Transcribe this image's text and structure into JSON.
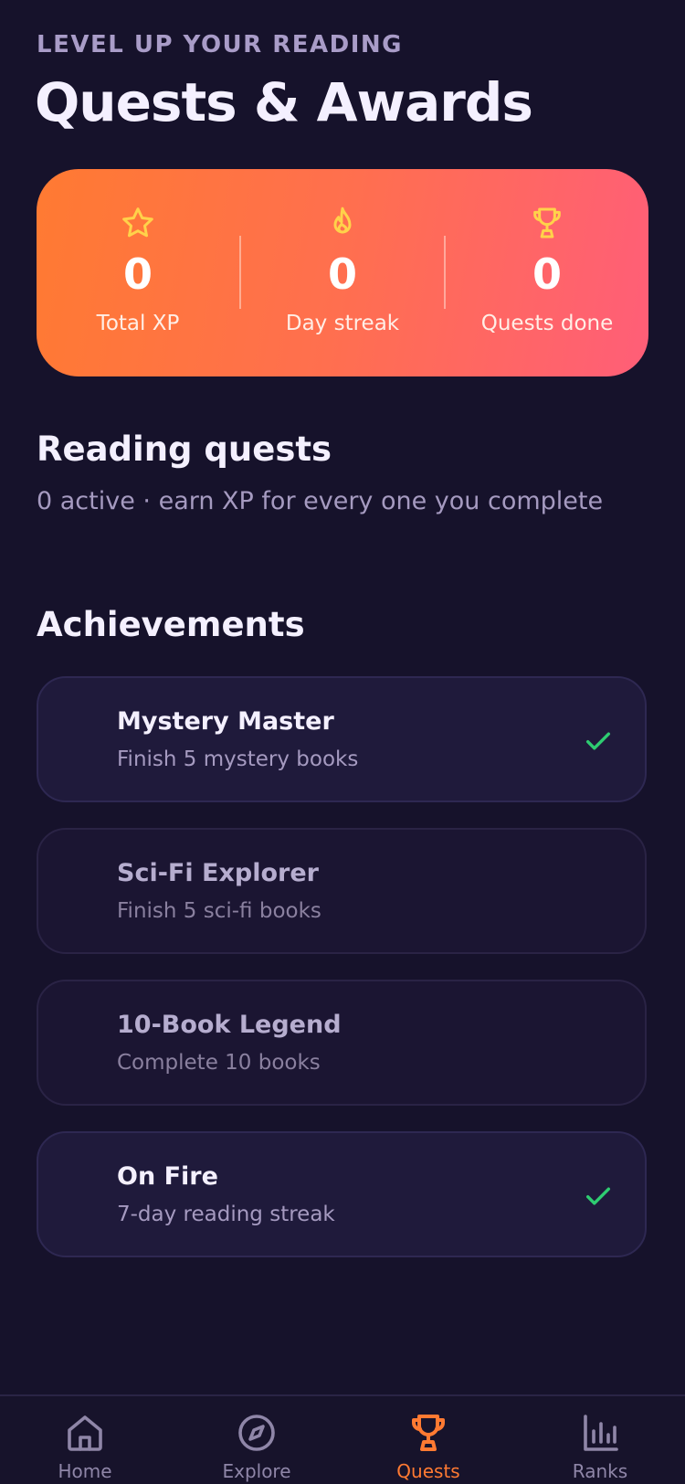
{
  "header": {
    "eyebrow": "LEVEL UP YOUR READING",
    "title": "Quests & Awards"
  },
  "stats": [
    {
      "icon": "star-icon",
      "value": "0",
      "label": "Total XP"
    },
    {
      "icon": "flame-icon",
      "value": "0",
      "label": "Day streak"
    },
    {
      "icon": "trophy-icon",
      "value": "0",
      "label": "Quests done"
    }
  ],
  "quests": {
    "title": "Reading quests",
    "subtitle": "0 active · earn XP for every one you complete"
  },
  "achievements": {
    "title": "Achievements",
    "items": [
      {
        "title": "Mystery Master",
        "description": "Finish 5 mystery books",
        "completed": true
      },
      {
        "title": "Sci-Fi Explorer",
        "description": "Finish 5 sci-fi books",
        "completed": false
      },
      {
        "title": "10-Book Legend",
        "description": "Complete 10 books",
        "completed": false
      },
      {
        "title": "On Fire",
        "description": "7-day reading streak",
        "completed": true
      }
    ]
  },
  "tabs": [
    {
      "label": "Home",
      "icon": "home-icon",
      "active": false
    },
    {
      "label": "Explore",
      "icon": "compass-icon",
      "active": false
    },
    {
      "label": "Quests",
      "icon": "trophy-icon",
      "active": true
    },
    {
      "label": "Ranks",
      "icon": "bar-chart-icon",
      "active": false
    }
  ],
  "colors": {
    "background": "#16122b",
    "accent": "#ff7a32",
    "gradient_end": "#ff5e78",
    "success": "#2ecc71",
    "stat_icon": "#ffd24a"
  }
}
